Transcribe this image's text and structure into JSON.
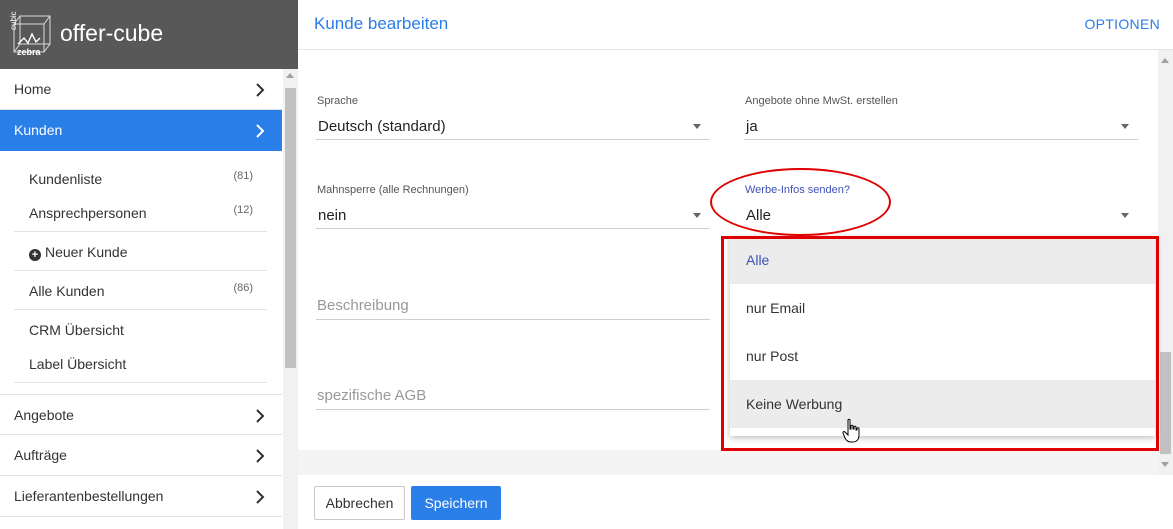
{
  "brand": {
    "logo_text_1": "cubic",
    "logo_text_2": "zebra",
    "name": "offer-cube"
  },
  "sidebar": {
    "items": [
      {
        "label": "Home"
      },
      {
        "label": "Kunden"
      },
      {
        "label": "Angebote"
      },
      {
        "label": "Aufträge"
      },
      {
        "label": "Lieferantenbestellungen"
      }
    ],
    "sub_items": [
      {
        "label": "Kundenliste",
        "count": "(81)"
      },
      {
        "label": "Ansprechpersonen",
        "count": "(12)"
      },
      {
        "label": "Neuer Kunde"
      },
      {
        "label": "Alle Kunden",
        "count": "(86)"
      },
      {
        "label": "CRM Übersicht"
      },
      {
        "label": "Label Übersicht"
      }
    ]
  },
  "header": {
    "title": "Kunde bearbeiten",
    "options": "OPTIONEN"
  },
  "form": {
    "sprache": {
      "label": "Sprache",
      "value": "Deutsch (standard)"
    },
    "mwst": {
      "label": "Angebote ohne MwSt. erstellen",
      "value": "ja"
    },
    "mahnsperre": {
      "label": "Mahnsperre (alle Rechnungen)",
      "value": "nein"
    },
    "werbe": {
      "label": "Werbe-Infos senden?",
      "value": "Alle"
    },
    "beschreibung": {
      "placeholder": "Beschreibung"
    },
    "agb": {
      "placeholder": "spezifische AGB"
    }
  },
  "dropdown": {
    "options": [
      {
        "label": "Alle"
      },
      {
        "label": "nur Email"
      },
      {
        "label": "nur Post"
      },
      {
        "label": "Keine Werbung"
      }
    ],
    "selected": "Alle",
    "hovered": "Keine Werbung"
  },
  "footer": {
    "cancel": "Abbrechen",
    "save": "Speichern"
  },
  "colors": {
    "accent": "#2a7ee8",
    "brand_bg": "#585858",
    "selected_option": "#3f51b5",
    "annotation": "#e00000"
  }
}
